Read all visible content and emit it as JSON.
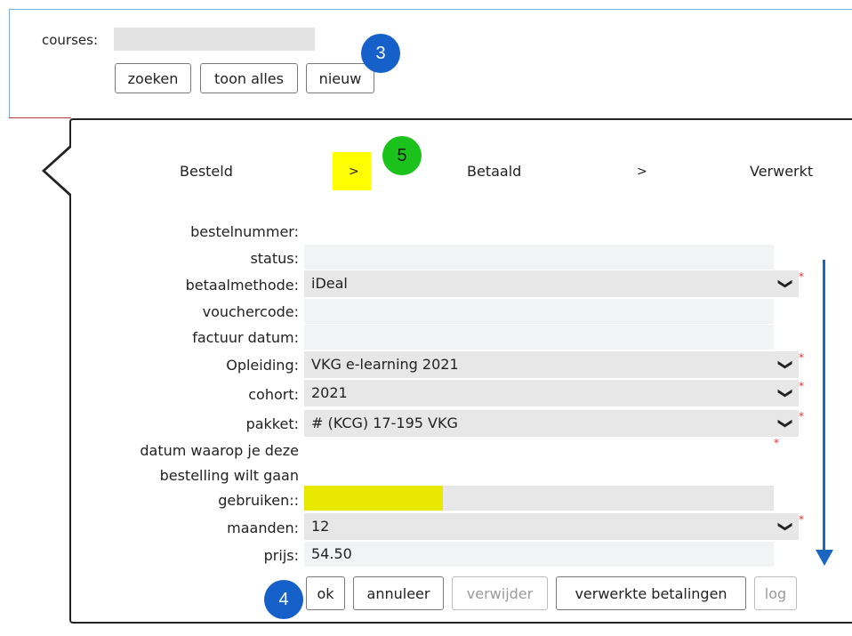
{
  "search": {
    "courses_label": "courses:",
    "courses_value": "",
    "buttons": {
      "search": "zoeken",
      "show_all": "toon alles",
      "new": "nieuw"
    }
  },
  "badges": {
    "b3": "3",
    "b4": "4",
    "b5": "5"
  },
  "steps": {
    "ordered": "Besteld",
    "sep1": ">",
    "paid": "Betaald",
    "sep2": ">",
    "processed": "Verwerkt"
  },
  "form": {
    "order_number": {
      "label": "bestelnummer:",
      "value": ""
    },
    "status": {
      "label": "status:",
      "value": ""
    },
    "payment_method": {
      "label": "betaalmethode:",
      "value": "iDeal"
    },
    "voucher_code": {
      "label": "vouchercode:",
      "value": ""
    },
    "invoice_date": {
      "label": "factuur datum:",
      "value": ""
    },
    "training": {
      "label": "Opleiding:",
      "value": "VKG e-learning 2021"
    },
    "cohort": {
      "label": "cohort:",
      "value": "2021"
    },
    "package": {
      "label": "pakket:",
      "value": "# (KCG) 17-195 VKG"
    },
    "use_date": {
      "label_l1": "datum waarop je deze",
      "label_l2": "bestelling wilt gaan",
      "label_l3": "gebruiken::",
      "value": ""
    },
    "months": {
      "label": "maanden:",
      "value": "12"
    },
    "price": {
      "label": "prijs:",
      "value": "54.50"
    }
  },
  "actions": {
    "ok": "ok",
    "cancel": "annuleer",
    "delete": "verwijder",
    "processed_payments": "verwerkte betalingen",
    "log": "log"
  },
  "icons": {
    "required": "*",
    "chevron": "❯"
  },
  "colors": {
    "badge_blue": "#1560c9",
    "badge_green": "#1cc21c",
    "highlight": "#ffff00",
    "arrow": "#1a66c2"
  }
}
